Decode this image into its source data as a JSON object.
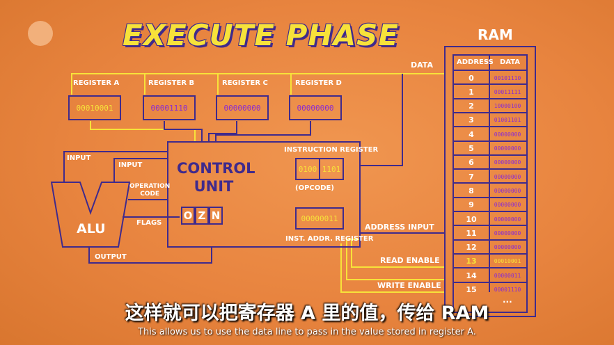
{
  "title": "EXECUTE PHASE",
  "logo": {
    "name": "pbs-logo"
  },
  "registers": [
    {
      "label": "REGISTER A",
      "value": "00010001"
    },
    {
      "label": "REGISTER B",
      "value": "00001110"
    },
    {
      "label": "REGISTER C",
      "value": "00000000"
    },
    {
      "label": "REGISTER D",
      "value": "00000000"
    }
  ],
  "control_unit": {
    "title_line1": "CONTROL",
    "title_line2": "UNIT",
    "instruction_register_label": "INSTRUCTION REGISTER",
    "opcode": "0100",
    "operand": "1101",
    "opcode_label": "(OPCODE)",
    "inst_addr_value": "00000011",
    "inst_addr_label": "INST. ADDR. REGISTER",
    "flags": [
      "O",
      "Z",
      "N"
    ]
  },
  "alu": {
    "label": "ALU",
    "input_a_label": "INPUT",
    "input_b_label": "INPUT",
    "operation_code_label_1": "OPERATION",
    "operation_code_label_2": "CODE",
    "flags_label": "FLAGS",
    "output_label": "OUTPUT"
  },
  "bus_labels": {
    "data": "DATA",
    "address_input": "ADDRESS INPUT",
    "read_enable": "READ ENABLE",
    "write_enable": "WRITE ENABLE"
  },
  "ram": {
    "title": "RAM",
    "col_address": "ADDRESS",
    "col_data": "DATA",
    "rows": [
      {
        "address": "0",
        "data": "00101110"
      },
      {
        "address": "1",
        "data": "00011111"
      },
      {
        "address": "2",
        "data": "10000100"
      },
      {
        "address": "3",
        "data": "01001101"
      },
      {
        "address": "4",
        "data": "00000000"
      },
      {
        "address": "5",
        "data": "00000000"
      },
      {
        "address": "6",
        "data": "00000000"
      },
      {
        "address": "7",
        "data": "00000000"
      },
      {
        "address": "8",
        "data": "00000000"
      },
      {
        "address": "9",
        "data": "00000000"
      },
      {
        "address": "10",
        "data": "00000000"
      },
      {
        "address": "11",
        "data": "00000000"
      },
      {
        "address": "12",
        "data": "00000000"
      },
      {
        "address": "13",
        "data": "00010001"
      },
      {
        "address": "14",
        "data": "00000011"
      },
      {
        "address": "15",
        "data": "00001110"
      }
    ],
    "ellipsis": "...",
    "highlight_index": 13
  },
  "subtitles": {
    "zh": "这样就可以把寄存器 A 里的值，传给 RAM",
    "en": "This allows us to use the data line to pass in the value stored in register A."
  },
  "colors": {
    "background": "#e8843f",
    "wire_purple": "#3f2a8c",
    "wire_yellow": "#f7e23a",
    "data_purple": "#8a2bd1",
    "text_white": "#ffffff"
  }
}
